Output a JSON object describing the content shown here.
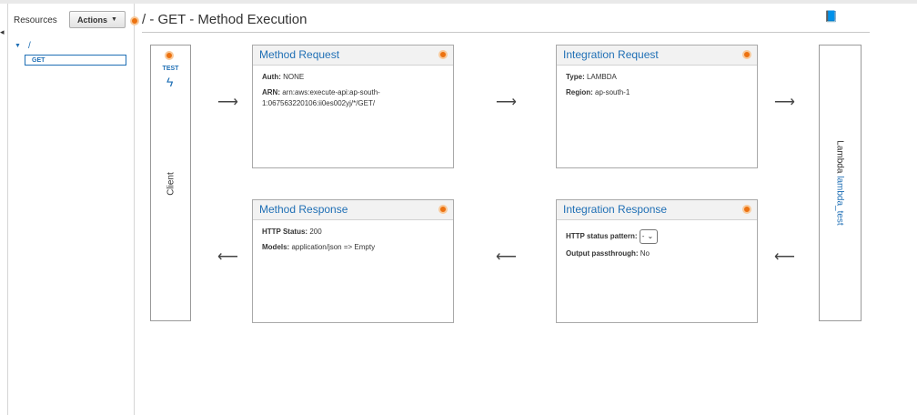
{
  "sidebar": {
    "resources_label": "Resources",
    "actions_label": "Actions",
    "tree_root": "/",
    "tree_method": "GET"
  },
  "header": {
    "title": "/ - GET - Method Execution"
  },
  "client": {
    "test_label": "TEST",
    "label": "Client"
  },
  "method_request": {
    "title": "Method Request",
    "auth_label": "Auth:",
    "auth_value": "NONE",
    "arn_label": "ARN:",
    "arn_value": "arn:aws:execute-api:ap-south-1:067563220106:ii0es002yj/*/GET/"
  },
  "integration_request": {
    "title": "Integration Request",
    "type_label": "Type:",
    "type_value": "LAMBDA",
    "region_label": "Region:",
    "region_value": "ap-south-1"
  },
  "method_response": {
    "title": "Method Response",
    "status_label": "HTTP Status:",
    "status_value": "200",
    "models_label": "Models:",
    "models_value": "application/json => Empty"
  },
  "integration_response": {
    "title": "Integration Response",
    "pattern_label": "HTTP status pattern:",
    "pattern_value": "-",
    "passthrough_label": "Output passthrough:",
    "passthrough_value": "No"
  },
  "lambda": {
    "prefix": "Lambda",
    "function_name": "lambda_test"
  },
  "colors": {
    "accent_link": "#1f6fb5",
    "status_dot": "#ec7211"
  },
  "icons": [
    "book-icon",
    "bolt-icon",
    "status-dot-icon",
    "arrow-right-icon",
    "arrow-left-icon",
    "caret-down-icon"
  ]
}
